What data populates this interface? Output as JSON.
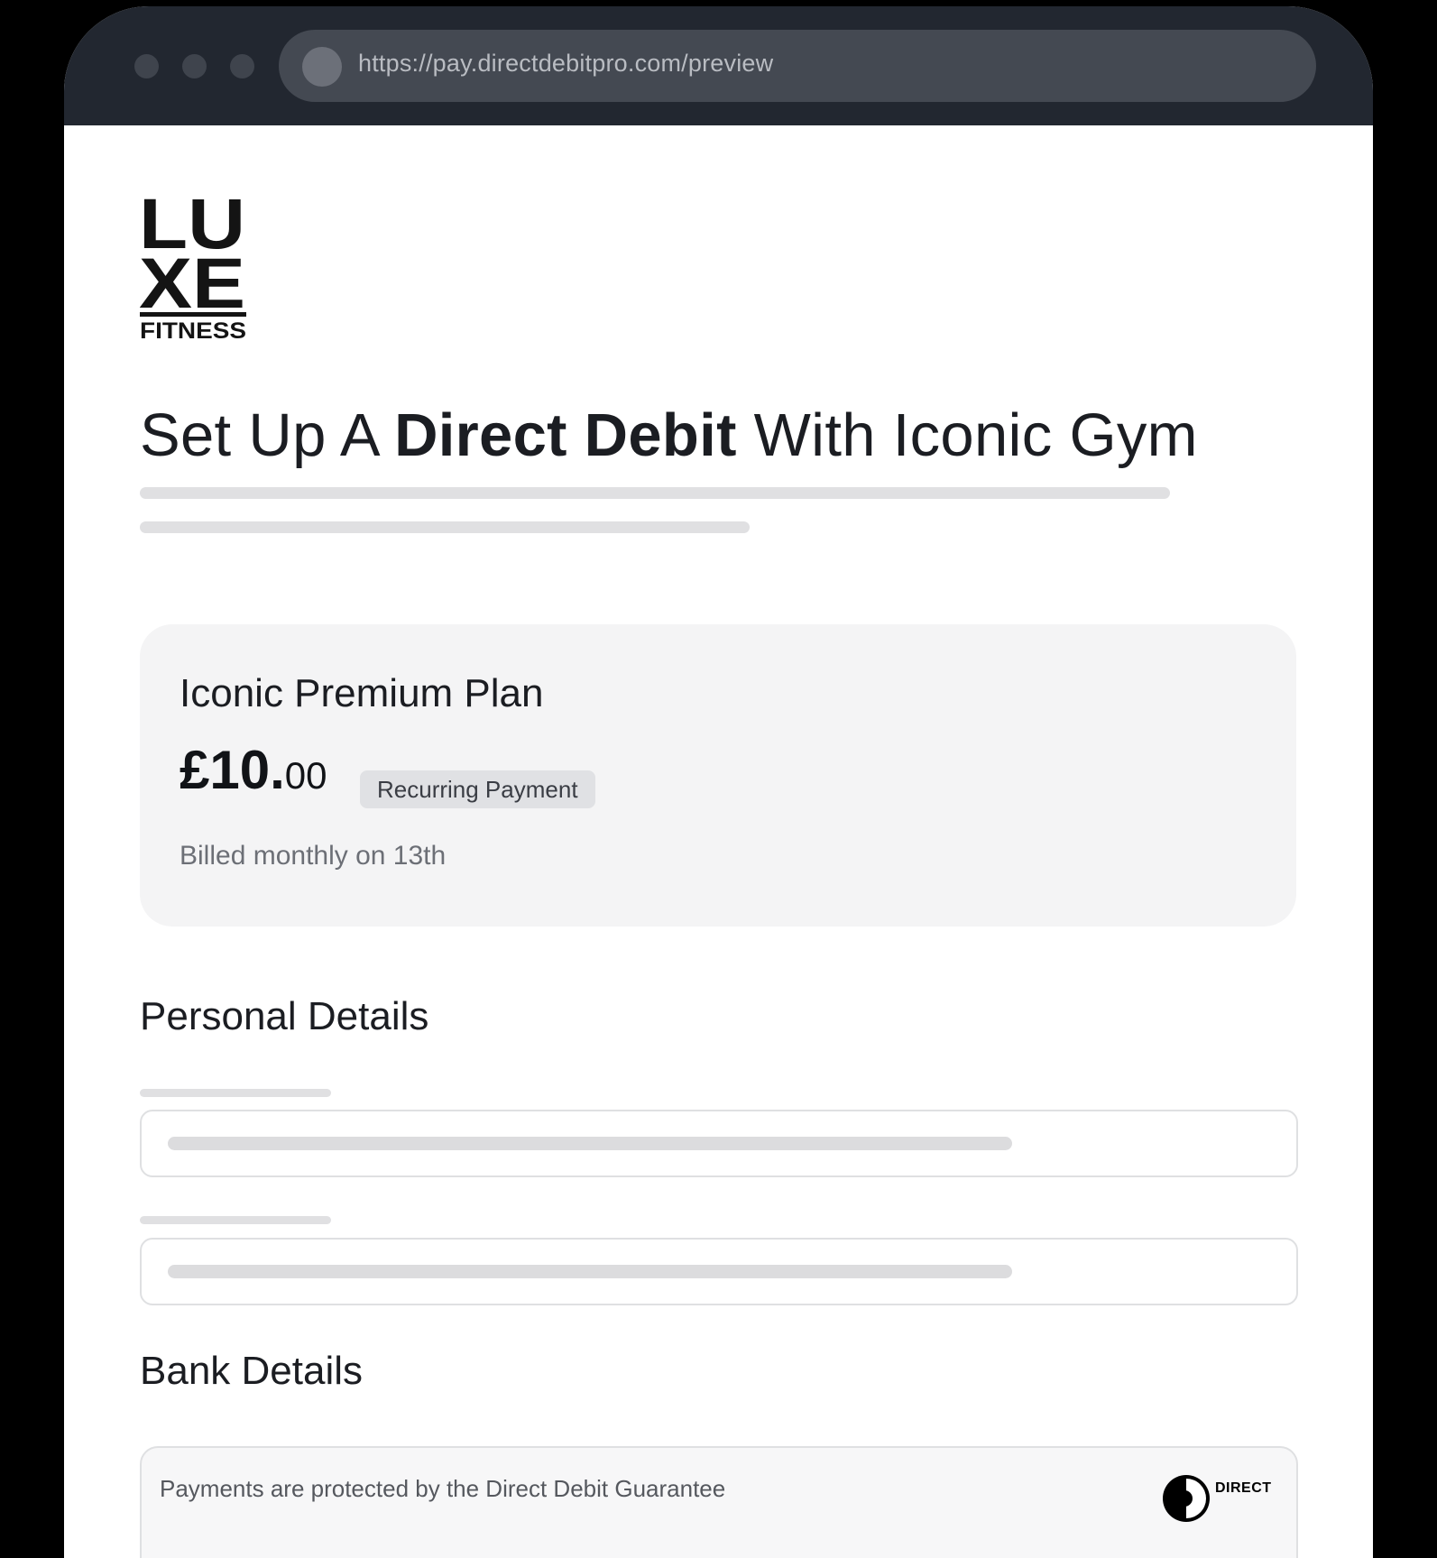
{
  "browser": {
    "url": "https://pay.directdebitpro.com/preview"
  },
  "logo": {
    "line1": "LU",
    "line2": "XE",
    "line3": "FITNESS"
  },
  "page": {
    "title_before": "Set Up A ",
    "title_bold": "Direct Debit",
    "title_after": " With Iconic Gym"
  },
  "plan": {
    "name": "Iconic Premium Plan",
    "price_main": "£10.",
    "price_decimal": "00",
    "badge": "Recurring Payment",
    "billing": "Billed monthly on 13th"
  },
  "sections": {
    "personal": "Personal Details",
    "bank": "Bank Details"
  },
  "bank": {
    "guarantee_text": "Payments are protected by the Direct Debit Guarantee",
    "dd_logo_word": "DIRECT"
  }
}
